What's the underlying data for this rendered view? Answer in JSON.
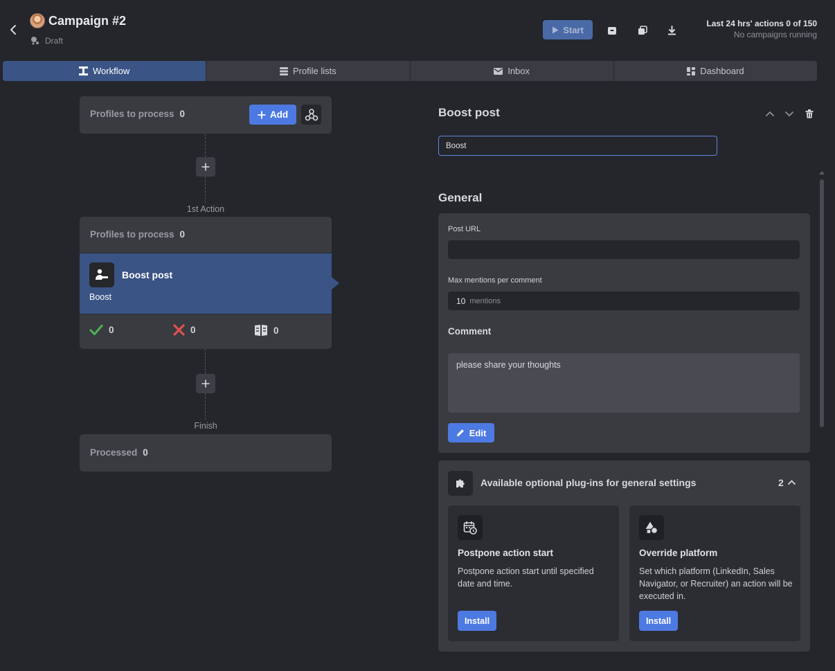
{
  "header": {
    "title": "Campaign #2",
    "status": "Draft",
    "start_label": "Start",
    "actions_stat": "Last 24 hrs' actions 0 of 150",
    "running_stat": "No campaigns running"
  },
  "tabs": [
    {
      "label": "Workflow",
      "icon": "workflow-icon",
      "active": true
    },
    {
      "label": "Profile lists",
      "icon": "list-icon",
      "active": false
    },
    {
      "label": "Inbox",
      "icon": "mail-icon",
      "active": false
    },
    {
      "label": "Dashboard",
      "icon": "dashboard-icon",
      "active": false
    }
  ],
  "workflow": {
    "start_node": {
      "label": "Profiles to process",
      "count": "0",
      "add_label": "Add"
    },
    "first_step_label": "1st Action",
    "action_node": {
      "label": "Profiles to process",
      "count": "0",
      "name": "Boost post",
      "subtitle": "Boost",
      "success_count": "0",
      "failed_count": "0",
      "skipped_count": "0"
    },
    "finish_label": "Finish",
    "finish_node": {
      "label": "Processed",
      "count": "0"
    }
  },
  "panel": {
    "title": "Boost post",
    "name_value": "Boost",
    "general_title": "General",
    "post_url_label": "Post URL",
    "post_url_value": "",
    "max_mentions_label": "Max mentions per comment",
    "max_mentions_value": "10",
    "max_mentions_unit": "mentions",
    "comment_title": "Comment",
    "comment_value": "please share your thoughts",
    "edit_label": "Edit"
  },
  "plugins": {
    "title": "Available optional plug-ins for general settings",
    "count": "2",
    "items": [
      {
        "title": "Postpone action start",
        "desc": "Postpone action start until specified date and time.",
        "button": "Install",
        "icon": "calendar-clock-icon"
      },
      {
        "title": "Override platform",
        "desc": "Set which platform (LinkedIn, Sales Navigator, or Recruiter) an action will be executed in.",
        "button": "Install",
        "icon": "shapes-icon"
      }
    ]
  },
  "colors": {
    "background": "#25262b",
    "card": "#3a3b41",
    "accent": "#4d7ae2",
    "selected": "#3a5485",
    "success": "#4caf50",
    "error": "#e05050"
  }
}
